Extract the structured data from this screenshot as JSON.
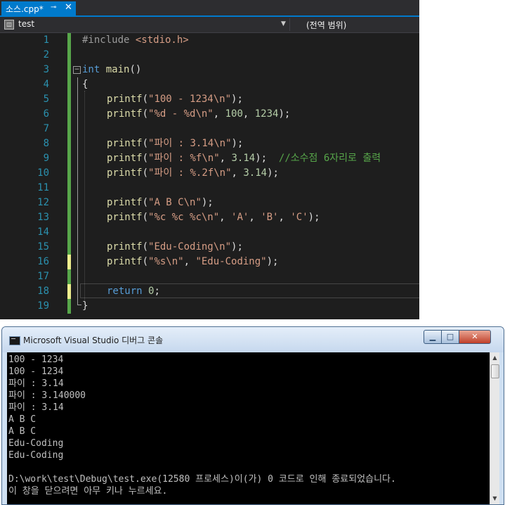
{
  "editor": {
    "tab": {
      "label": "소스.cpp*",
      "pin": "⊸",
      "close": "✕"
    },
    "nav": {
      "left_label": "test",
      "left_icon": "project-icon",
      "dropdown_icon": "chevron-down-icon",
      "right_label": "(전역 범위)"
    },
    "line_numbers": [
      "1",
      "2",
      "3",
      "4",
      "5",
      "6",
      "7",
      "8",
      "9",
      "10",
      "11",
      "12",
      "13",
      "14",
      "15",
      "16",
      "17",
      "18",
      "19"
    ],
    "code": {
      "l1": {
        "pre": "#include ",
        "inc": "<stdio.h>"
      },
      "l3": {
        "kw": "int",
        "fn": "main",
        "rest": "()"
      },
      "l4": "{",
      "l5": {
        "fn": "printf",
        "open": "(",
        "str": "\"100 - 1234\\n\"",
        "close": ");"
      },
      "l6": {
        "fn": "printf",
        "open": "(",
        "str": "\"%d - %d\\n\"",
        "mid1": ", ",
        "n1": "100",
        "mid2": ", ",
        "n2": "1234",
        "close": ");"
      },
      "l8": {
        "fn": "printf",
        "open": "(",
        "str": "\"파이 : 3.14\\n\"",
        "close": ");"
      },
      "l9": {
        "fn": "printf",
        "open": "(",
        "str": "\"파이 : %f\\n\"",
        "mid": ", ",
        "num": "3.14",
        "close": ");",
        "comment": "  //소수점 6자리로 출력"
      },
      "l10": {
        "fn": "printf",
        "open": "(",
        "str": "\"파이 : %.2f\\n\"",
        "mid": ", ",
        "num": "3.14",
        "close": ");"
      },
      "l12": {
        "fn": "printf",
        "open": "(",
        "str": "\"A B C\\n\"",
        "close": ");"
      },
      "l13": {
        "fn": "printf",
        "open": "(",
        "str": "\"%c %c %c\\n\"",
        "m1": ", ",
        "c1": "'A'",
        "m2": ", ",
        "c2": "'B'",
        "m3": ", ",
        "c3": "'C'",
        "close": ");"
      },
      "l15": {
        "fn": "printf",
        "open": "(",
        "str": "\"Edu-Coding\\n\"",
        "close": ");"
      },
      "l16": {
        "fn": "printf",
        "open": "(",
        "str": "\"%s\\n\"",
        "mid": ", ",
        "str2": "\"Edu-Coding\"",
        "close": ");"
      },
      "l18": {
        "kw": "return",
        "sp": " ",
        "num": "0",
        "close": ";"
      },
      "l19": "}"
    },
    "colors": {
      "saved_change": "#57a64a",
      "unsaved_change": "#efef8f",
      "accent": "#007acc"
    }
  },
  "console": {
    "title": "Microsoft Visual Studio 디버그 콘솔",
    "buttons": {
      "minimize": "▁",
      "maximize": "□",
      "close": "✕"
    },
    "output": [
      "100 - 1234",
      "100 - 1234",
      "파이 : 3.14",
      "파이 : 3.140000",
      "파이 : 3.14",
      "A B C",
      "A B C",
      "Edu-Coding",
      "Edu-Coding",
      "",
      "D:\\work\\test\\Debug\\test.exe(12580 프로세스)이(가) 0 코드로 인해 종료되었습니다.",
      "이 창을 닫으려면 아무 키나 누르세요."
    ],
    "scroll_up": "▲",
    "scroll_down": "▼"
  }
}
